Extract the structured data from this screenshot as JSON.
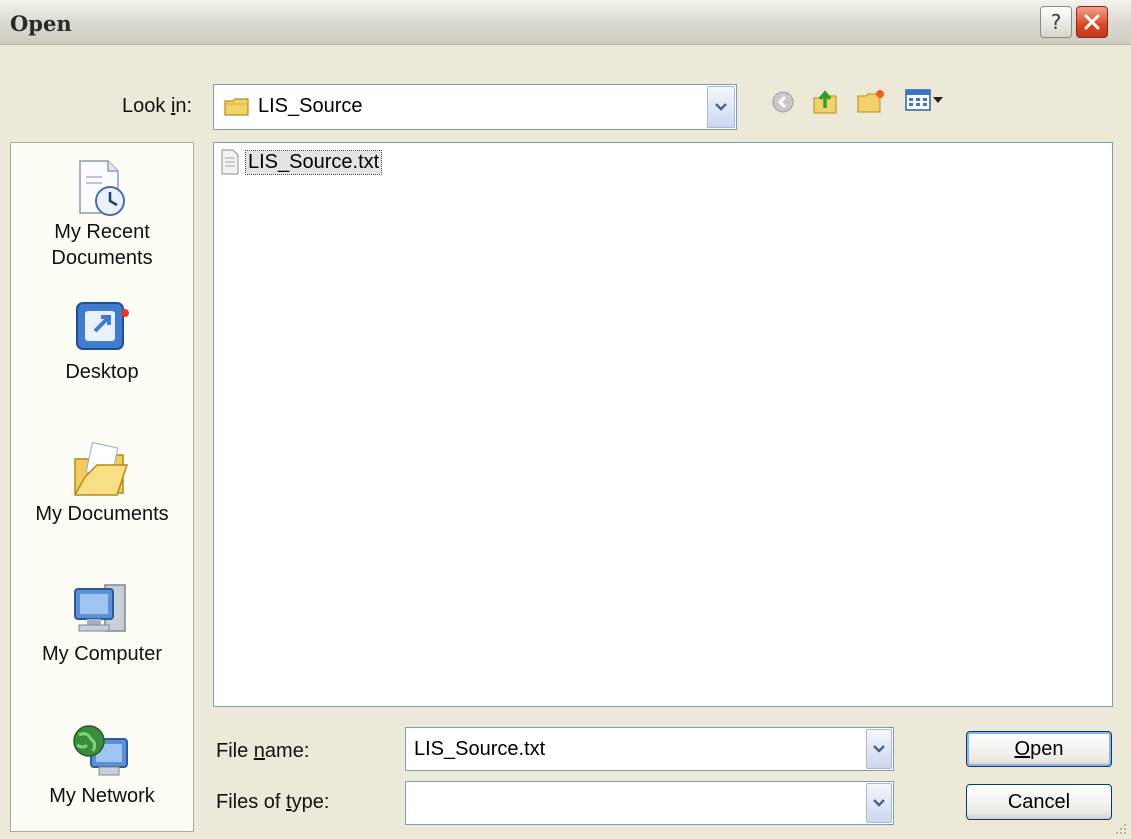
{
  "dialog": {
    "title": "Open"
  },
  "title_buttons": {
    "help": "?"
  },
  "lookin": {
    "label": "Look in:",
    "label_pre": "Look ",
    "label_key": "i",
    "label_post": "n:",
    "value": "LIS_Source"
  },
  "places": [
    {
      "id": "recent",
      "label_line1": "My Recent",
      "label_line2": "Documents",
      "icon": "recent-documents-icon"
    },
    {
      "id": "desktop",
      "label_line1": "Desktop",
      "icon": "desktop-icon"
    },
    {
      "id": "mydocs",
      "label_line1": "My Documents",
      "icon": "my-documents-icon"
    },
    {
      "id": "mycomputer",
      "label_line1": "My Computer",
      "icon": "my-computer-icon"
    },
    {
      "id": "network",
      "label_line1": "My Network",
      "icon": "my-network-icon"
    }
  ],
  "files": [
    {
      "name": "LIS_Source.txt",
      "icon": "text-file-icon",
      "selected": true
    }
  ],
  "filename": {
    "label": "File name:",
    "label_pre": "File ",
    "label_key": "n",
    "label_post": "ame:",
    "value": "LIS_Source.txt"
  },
  "filetype": {
    "label": "Files of type:",
    "label_pre": "Files of ",
    "label_key": "t",
    "label_post": "ype:",
    "value": ""
  },
  "buttons": {
    "open": "Open",
    "open_key": "O",
    "open_rest": "pen",
    "cancel": "Cancel"
  },
  "colors": {
    "titlebar": "#dcdad0",
    "face": "#ece9d8",
    "border_blue": "#7f9db9",
    "close_red": "#d8472a",
    "selection": "#e4e4e4"
  }
}
